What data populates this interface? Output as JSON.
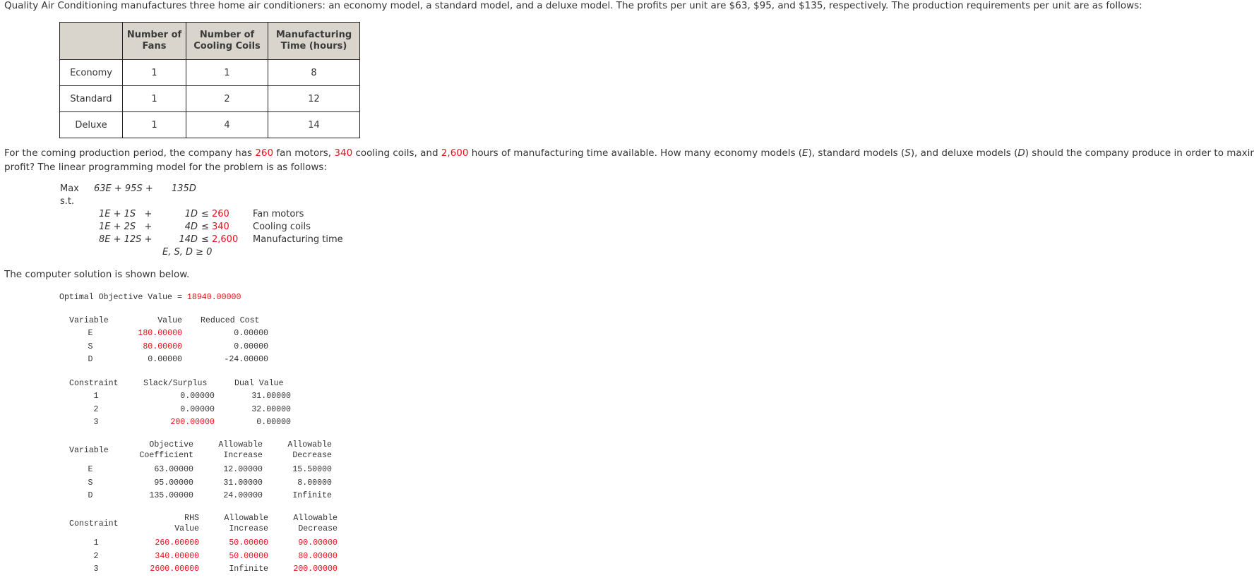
{
  "intro": {
    "text": "Quality Air Conditioning manufactures three home air conditioners: an economy model, a standard model, and a deluxe model. The profits per unit are $63, $95, and $135, respectively. The production requirements per unit are as follows:"
  },
  "requirements_table": {
    "headers": [
      "",
      "Number of\nFans",
      "Number of\nCooling Coils",
      "Manufacturing\nTime (hours)"
    ],
    "header_lines": [
      [
        "",
        ""
      ],
      [
        "Number of",
        "Fans"
      ],
      [
        "Number of",
        "Cooling Coils"
      ],
      [
        "Manufacturing",
        "Time (hours)"
      ]
    ],
    "rows": [
      {
        "model": "Economy",
        "fans": "1",
        "coils": "1",
        "hours": "8"
      },
      {
        "model": "Standard",
        "fans": "1",
        "coils": "2",
        "hours": "12"
      },
      {
        "model": "Deluxe",
        "fans": "1",
        "coils": "4",
        "hours": "14"
      }
    ]
  },
  "paragraph": {
    "p1": "For the coming production period, the company has ",
    "fan_motors": "260",
    "p2": " fan motors, ",
    "cooling_coils": "340",
    "p3": " cooling coils, and ",
    "hours": "2,600",
    "p4": " hours of manufacturing time available. How many economy models (",
    "E": "E",
    "p5": "), standard models (",
    "S": "S",
    "p6": "), and deluxe models (",
    "D": "D",
    "p7": ") should the company produce in order to maximize",
    "line2": "profit? The linear programming model for the problem is as follows:"
  },
  "model": {
    "max_label": "Max",
    "objective_left": "63E + 95S +",
    "objective_right": "135D",
    "st_label": "s.t.",
    "constraints": [
      {
        "lhs": "1E + 1S   +",
        "d": "1D",
        "op": "≤",
        "rhs": "260",
        "name": "Fan motors"
      },
      {
        "lhs": "1E + 2S   +",
        "d": "4D",
        "op": "≤",
        "rhs": "340",
        "name": "Cooling coils"
      },
      {
        "lhs": "8E + 12S +",
        "d": "14D",
        "op": "≤",
        "rhs": "2,600",
        "name": "Manufacturing time"
      }
    ],
    "nonneg": "E, S, D ≥ 0"
  },
  "solution_intro": "The computer solution is shown below.",
  "solution": {
    "objective_label": "Optimal Objective Value = ",
    "objective_value": "18940.00000",
    "variables_header": {
      "variable": "Variable",
      "value": "Value",
      "reduced_cost": "Reduced Cost"
    },
    "variables": [
      {
        "name": "E",
        "value": "180.00000",
        "reduced_cost": "0.00000",
        "highlight": true
      },
      {
        "name": "S",
        "value": "80.00000",
        "reduced_cost": "0.00000",
        "highlight": true
      },
      {
        "name": "D",
        "value": "0.00000",
        "reduced_cost": "-24.00000",
        "highlight": false
      }
    ],
    "constraints_header": {
      "constraint": "Constraint",
      "slack": "Slack/Surplus",
      "dual": "Dual Value"
    },
    "constraints": [
      {
        "name": "1",
        "slack": "0.00000",
        "dual": "31.00000",
        "highlight": false
      },
      {
        "name": "2",
        "slack": "0.00000",
        "dual": "32.00000",
        "highlight": false
      },
      {
        "name": "3",
        "slack": "200.00000",
        "dual": "0.00000",
        "highlight": true
      }
    ],
    "obj_ranging_header": {
      "variable": "Variable",
      "coef_l1": "Objective",
      "coef_l2": "Coefficient",
      "inc_l1": "Allowable",
      "inc_l2": "Increase",
      "dec_l1": "Allowable",
      "dec_l2": "Decrease"
    },
    "obj_ranging": [
      {
        "name": "E",
        "coef": "63.00000",
        "inc": "12.00000",
        "dec": "15.50000"
      },
      {
        "name": "S",
        "coef": "95.00000",
        "inc": "31.00000",
        "dec": "8.00000"
      },
      {
        "name": "D",
        "coef": "135.00000",
        "inc": "24.00000",
        "dec": "Infinite"
      }
    ],
    "rhs_ranging_header": {
      "constraint": "Constraint",
      "rhs_l1": "RHS",
      "rhs_l2": "Value",
      "inc_l1": "Allowable",
      "inc_l2": "Increase",
      "dec_l1": "Allowable",
      "dec_l2": "Decrease"
    },
    "rhs_ranging": [
      {
        "name": "1",
        "rhs": "260.00000",
        "inc": "50.00000",
        "dec": "90.00000"
      },
      {
        "name": "2",
        "rhs": "340.00000",
        "inc": "50.00000",
        "dec": "80.00000"
      },
      {
        "name": "3",
        "rhs": "2600.00000",
        "inc": "Infinite",
        "dec": "200.00000"
      }
    ]
  },
  "colors": {
    "highlight": "#e8101a",
    "table_header_bg": "#d9d5cc",
    "text": "#333333"
  }
}
